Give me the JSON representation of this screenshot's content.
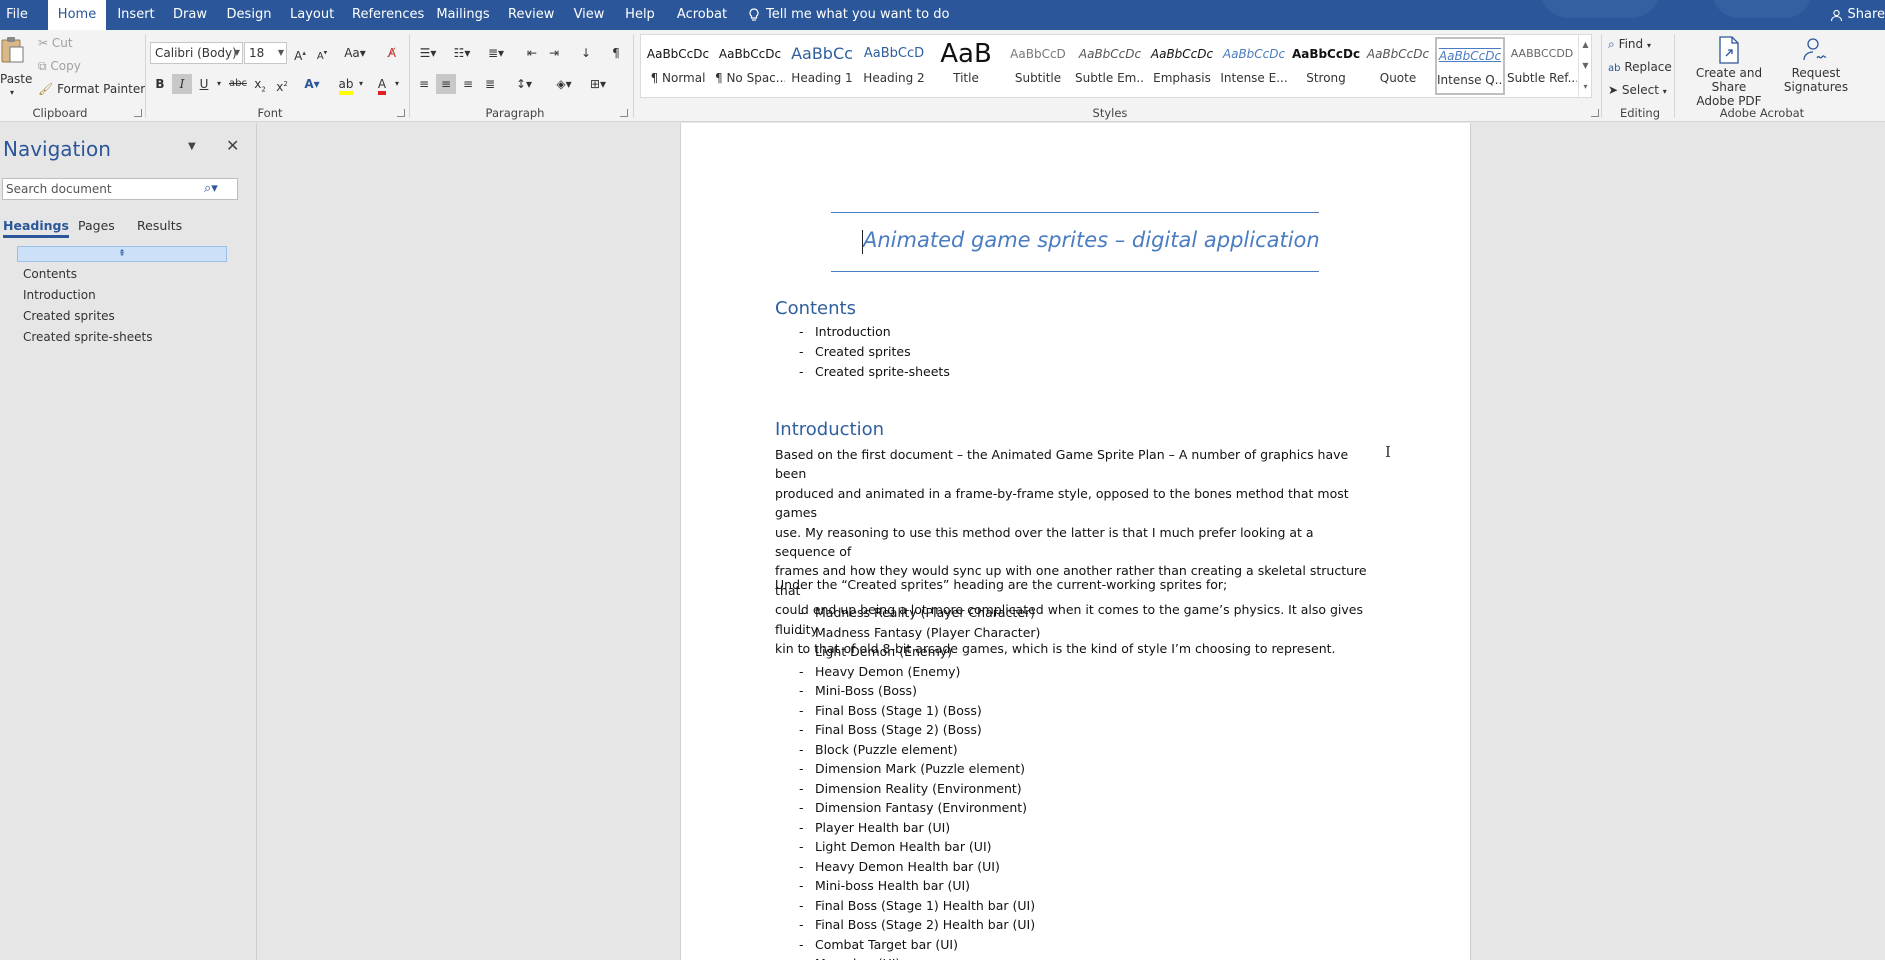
{
  "menu": {
    "tabs": [
      "File",
      "Home",
      "Insert",
      "Draw",
      "Design",
      "Layout",
      "References",
      "Mailings",
      "Review",
      "View",
      "Help",
      "Acrobat"
    ],
    "tell_me": "Tell me what you want to do",
    "share": "Share"
  },
  "ribbon": {
    "clipboard": {
      "paste": "Paste",
      "cut": "Cut",
      "copy": "Copy",
      "format_painter": "Format Painter",
      "label": "Clipboard"
    },
    "font": {
      "name": "Calibri (Body)",
      "size": "18",
      "label": "Font"
    },
    "paragraph": {
      "label": "Paragraph"
    },
    "styles": {
      "label": "Styles",
      "items": [
        {
          "sample": "AaBbCcDc",
          "name": "¶ Normal"
        },
        {
          "sample": "AaBbCcDc",
          "name": "¶ No Spac..."
        },
        {
          "sample": "AaBbCc",
          "name": "Heading 1"
        },
        {
          "sample": "AaBbCcD",
          "name": "Heading 2"
        },
        {
          "sample": "AaB",
          "name": "Title"
        },
        {
          "sample": "AaBbCcD",
          "name": "Subtitle"
        },
        {
          "sample": "AaBbCcDc",
          "name": "Subtle Em..."
        },
        {
          "sample": "AaBbCcDc",
          "name": "Emphasis"
        },
        {
          "sample": "AaBbCcDc",
          "name": "Intense E..."
        },
        {
          "sample": "AaBbCcDc",
          "name": "Strong"
        },
        {
          "sample": "AaBbCcDc",
          "name": "Quote"
        },
        {
          "sample": "AaBbCcDc",
          "name": "Intense Q..."
        },
        {
          "sample": "AABBCCDD",
          "name": "Subtle Ref..."
        }
      ]
    },
    "editing": {
      "find": "Find",
      "replace": "Replace",
      "select": "Select",
      "label": "Editing"
    },
    "acrobat": {
      "create": "Create and Share",
      "create2": "Adobe PDF",
      "request": "Request",
      "request2": "Signatures",
      "label": "Adobe Acrobat"
    }
  },
  "nav": {
    "title": "Navigation",
    "search_placeholder": "Search document",
    "tabs": [
      "Headings",
      "Pages",
      "Results"
    ],
    "headings": [
      "Contents",
      "Introduction",
      "Created sprites",
      "Created sprite-sheets"
    ]
  },
  "doc": {
    "title": "Animated game sprites – digital application",
    "contents_heading": "Contents",
    "contents_items": [
      "Introduction",
      "Created sprites",
      "Created sprite-sheets"
    ],
    "intro_heading": "Introduction",
    "intro_lines": [
      "Based on the first document – the Animated Game Sprite Plan – A number of graphics have been",
      "produced and animated in a frame-by-frame style, opposed to the bones method that most games",
      "use. My reasoning to use this method over the latter is that I much prefer looking at a sequence of",
      "frames and how they would sync up with one another rather than creating a skeletal structure that",
      "could end up being a lot more complicated when it comes to the game’s physics. It also gives fluidity",
      "kin to that of old 8-bit arcade games, which is the kind of style I’m choosing to represent."
    ],
    "under_heading": "Under the “Created sprites” heading are the current-working sprites for;",
    "sprites": [
      "Madness Reality (Player Character)",
      "Madness Fantasy (Player Character)",
      "Light Demon (Enemy)",
      "Heavy Demon (Enemy)",
      "Mini-Boss (Boss)",
      "Final Boss (Stage 1) (Boss)",
      "Final Boss (Stage 2) (Boss)",
      "Block (Puzzle element)",
      "Dimension Mark (Puzzle element)",
      "Dimension Reality (Environment)",
      "Dimension Fantasy (Environment)",
      "Player Health bar (UI)",
      "Light Demon Health bar (UI)",
      "Heavy Demon Health bar (UI)",
      "Mini-boss Health bar (UI)",
      "Final Boss (Stage 1) Health bar (UI)",
      "Final Boss (Stage 2) Health bar (UI)",
      "Combat Target bar (UI)",
      "Mana bar (UI)"
    ]
  },
  "colors": {
    "brand": "#2b579a",
    "heading": "#2f5f9f",
    "title": "#4a7cc0"
  }
}
